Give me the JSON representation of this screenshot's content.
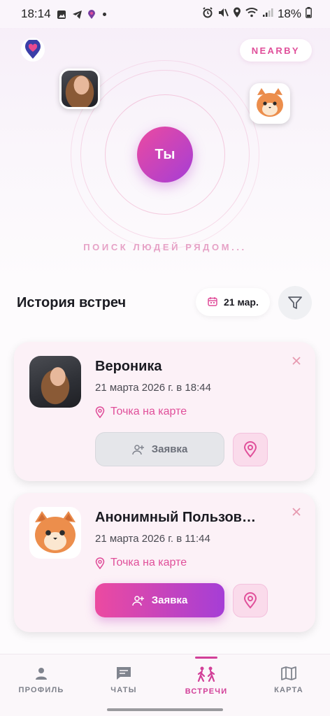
{
  "status_bar": {
    "time": "18:14",
    "battery": "18%",
    "icons": [
      "gallery-icon",
      "telegram-icon",
      "location-pin-icon",
      "dot-icon",
      "alarm-icon",
      "mute-icon",
      "location-icon",
      "wifi-icon",
      "signal-icon",
      "battery-icon"
    ]
  },
  "header": {
    "logo_icon": "heart-pin-logo",
    "nearby_label": "NEARBY"
  },
  "radar": {
    "you_label": "Ты",
    "caption": "ПОИСК ЛЮДЕЙ РЯДОМ...",
    "avatars": [
      "photo-avatar",
      "cat-avatar"
    ]
  },
  "history": {
    "title": "История встреч",
    "date_label": "21 мар.",
    "date_icon": "calendar-icon",
    "filter_icon": "filter-icon"
  },
  "meetings": [
    {
      "name": "Вероника",
      "time": "21 марта 2026 г. в 18:44",
      "location_label": "Точка на карте",
      "request_label": "Заявка",
      "request_state": "disabled",
      "avatar": "photo"
    },
    {
      "name": "Анонимный Пользов…",
      "time": "21 марта 2026 г. в 11:44",
      "location_label": "Точка на карте",
      "request_label": "Заявка",
      "request_state": "active",
      "avatar": "cat"
    }
  ],
  "nav": {
    "items": [
      {
        "label": "ПРОФИЛЬ",
        "icon": "person-icon",
        "active": false
      },
      {
        "label": "ЧАТЫ",
        "icon": "chat-icon",
        "active": false
      },
      {
        "label": "ВСТРЕЧИ",
        "icon": "walking-people-icon",
        "active": true
      },
      {
        "label": "КАРТА",
        "icon": "map-icon",
        "active": false
      }
    ]
  },
  "colors": {
    "accent_pink": "#e04f9a",
    "gradient_start": "#ec4aa0",
    "gradient_end": "#a53ed6",
    "card_bg": "#fcf1f7"
  }
}
